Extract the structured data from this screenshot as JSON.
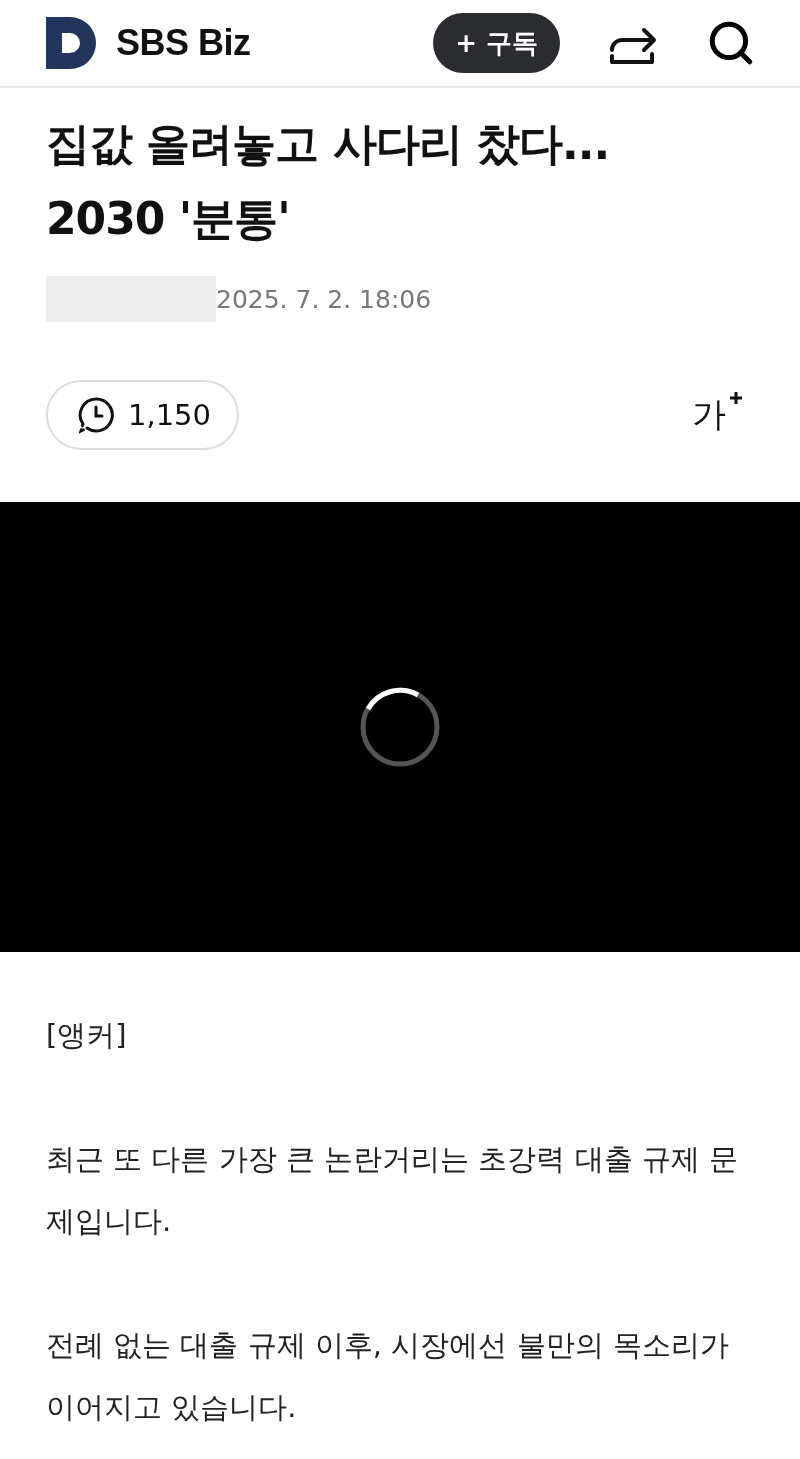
{
  "header": {
    "brand": "SBS Biz",
    "subscribe": "+ 구독"
  },
  "article": {
    "title_lines": [
      "집값 올려놓고 사다리 찼다...",
      "2030 '분통'"
    ],
    "date": "2025. 7. 2. 18:06",
    "views": "1,150",
    "font_size_label": "가",
    "video": {
      "loading": true
    },
    "paragraphs": [
      "[앵커]",
      "최근 또 다른 가장 큰 논란거리는 초강력 대출 규제 문제입니다.",
      "전례 없는 대출 규제 이후, 시장에선 불만의 목소리가 이어지고 있습니다."
    ]
  }
}
